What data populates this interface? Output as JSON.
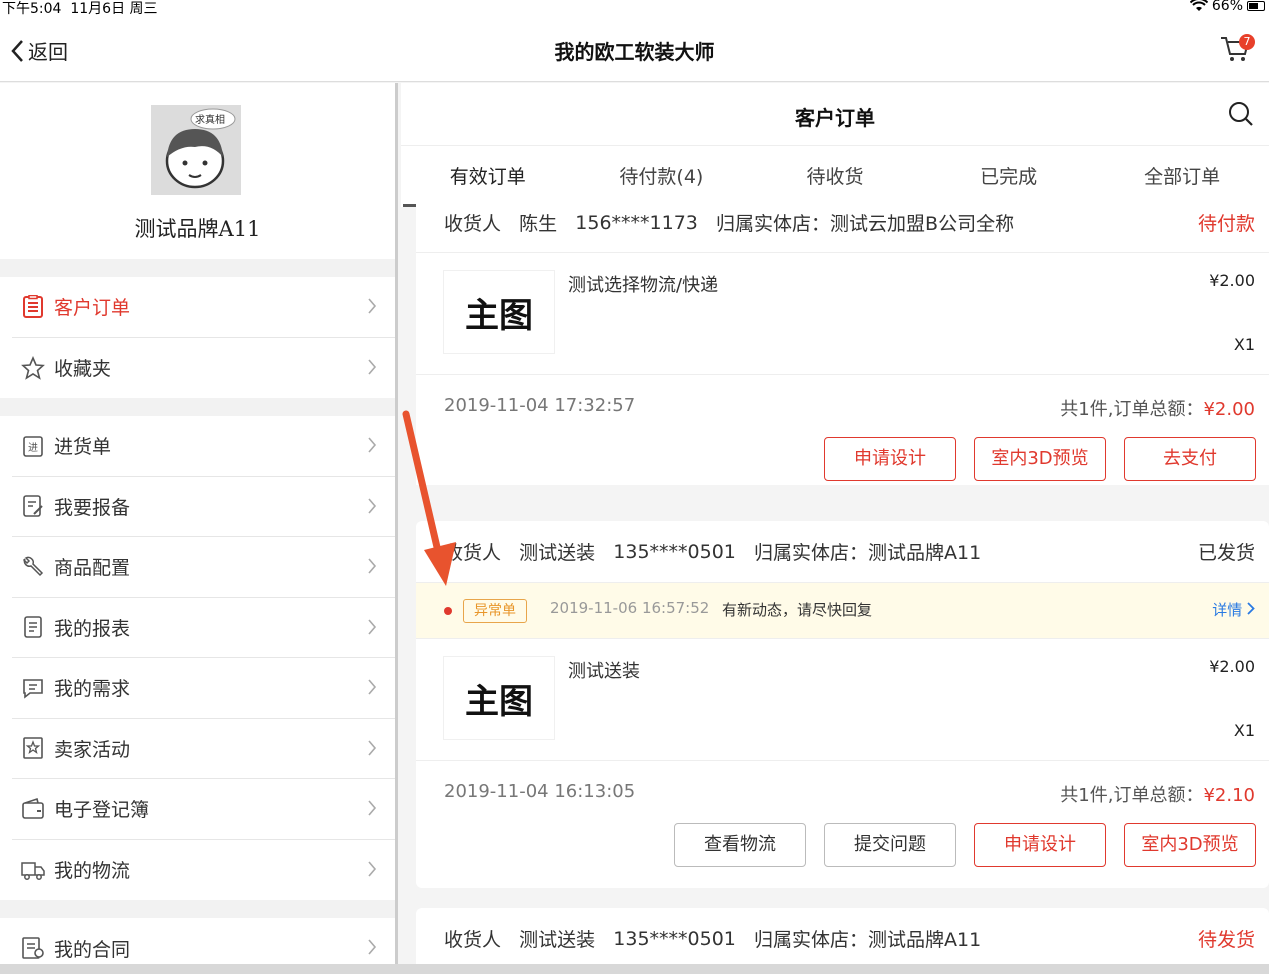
{
  "status_bar": {
    "time": "下午5:04",
    "date": "11月6日 周三",
    "battery": "66%"
  },
  "nav": {
    "back_label": "返回",
    "title": "我的欧工软装大师",
    "cart_badge": "7"
  },
  "sidebar": {
    "avatar_bubble": "求真相",
    "brand_name": "测试品牌A11",
    "group1": [
      {
        "label": "客户订单",
        "icon": "order-icon",
        "active": true
      },
      {
        "label": "收藏夹",
        "icon": "star-icon"
      }
    ],
    "group2": [
      {
        "label": "进货单",
        "icon": "purchase-icon"
      },
      {
        "label": "我要报备",
        "icon": "report-edit-icon"
      },
      {
        "label": "商品配置",
        "icon": "wrench-icon"
      },
      {
        "label": "我的报表",
        "icon": "document-icon"
      },
      {
        "label": "我的需求",
        "icon": "message-icon"
      },
      {
        "label": "卖家活动",
        "icon": "activity-icon"
      },
      {
        "label": "电子登记簿",
        "icon": "wallet-icon"
      },
      {
        "label": "我的物流",
        "icon": "truck-icon"
      }
    ],
    "group3": [
      {
        "label": "我的合同",
        "icon": "contract-icon"
      }
    ]
  },
  "main": {
    "title": "客户订单",
    "tabs": [
      "有效订单",
      "待付款(4)",
      "待收货",
      "已完成",
      "全部订单"
    ],
    "orders": [
      {
        "receiver_label": "收货人",
        "receiver": "陈生",
        "phone": "156****1173",
        "store_label": "归属实体店：",
        "store": "测试云加盟B公司全称",
        "status": "待付款",
        "thumb": "主图",
        "product": "测试选择物流/快递",
        "price": "¥2.00",
        "qty": "X1",
        "date": "2019-11-04 17:32:57",
        "total_label": "共1件,订单总额：",
        "total": "¥2.00",
        "buttons": [
          "申请设计",
          "室内3D预览",
          "去支付"
        ]
      },
      {
        "receiver_label": "收货人",
        "receiver": "测试送装",
        "phone": "135****0501",
        "store_label": "归属实体店：",
        "store": "测试品牌A11",
        "status": "已发货",
        "alert_tag": "异常单",
        "alert_time": "2019-11-06 16:57:52",
        "alert_text": "有新动态，请尽快回复",
        "alert_detail": "详情",
        "thumb": "主图",
        "product": "测试送装",
        "price": "¥2.00",
        "qty": "X1",
        "date": "2019-11-04 16:13:05",
        "total_label": "共1件,订单总额：",
        "total": "¥2.10",
        "buttons": [
          "查看物流",
          "提交问题",
          "申请设计",
          "室内3D预览"
        ]
      },
      {
        "receiver_label": "收货人",
        "receiver": "测试送装",
        "phone": "135****0501",
        "store_label": "归属实体店：",
        "store": "测试品牌A11",
        "status": "待发货"
      }
    ]
  },
  "colors": {
    "accent": "#e0392e",
    "link": "#2a7ae2",
    "warning": "#e8962a"
  }
}
